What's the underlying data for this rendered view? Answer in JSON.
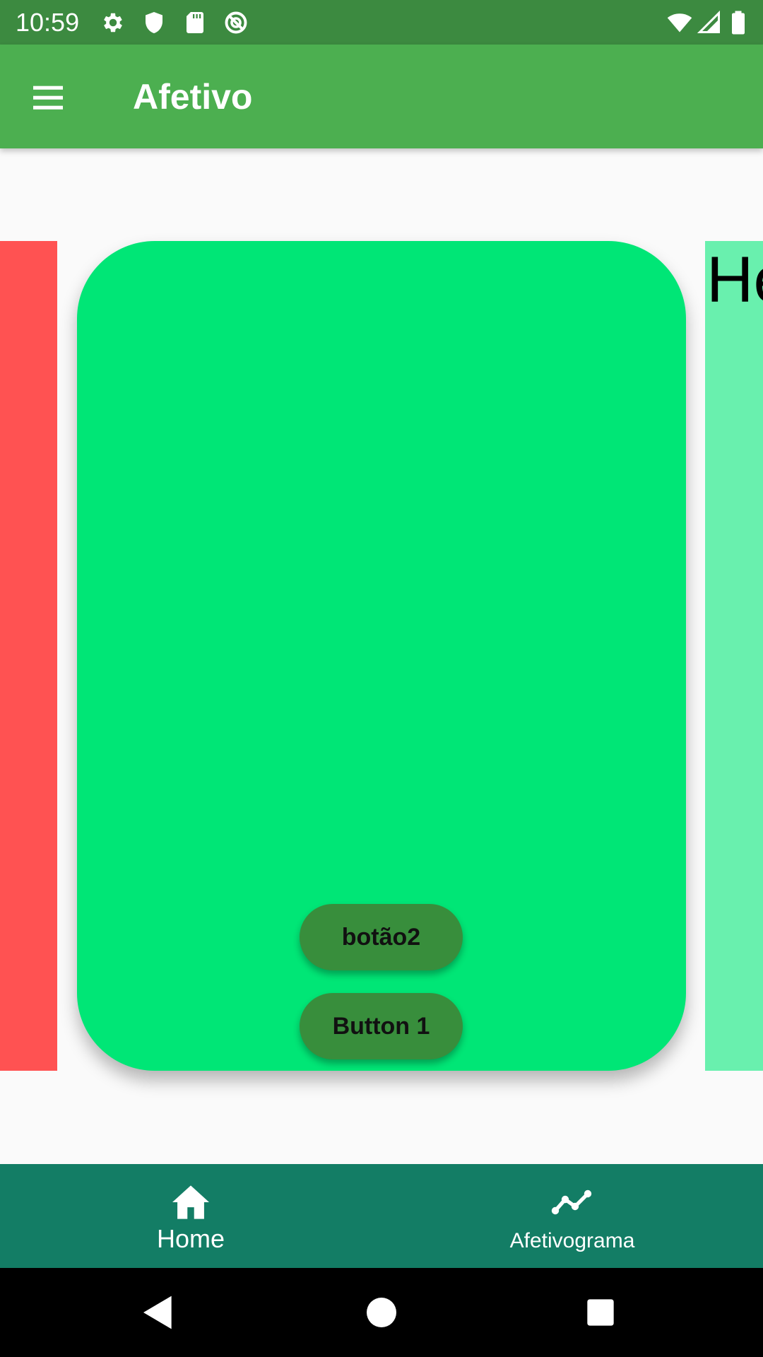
{
  "status_bar": {
    "time": "10:59",
    "icons": [
      "gear-icon",
      "shield-icon",
      "sd-card-icon",
      "no-disturb-icon",
      "wifi-icon",
      "signal-icon",
      "battery-icon"
    ],
    "background_color": "#3c8a40"
  },
  "app_bar": {
    "title": "Afetivo",
    "menu_icon": "hamburger-menu-icon",
    "background_color": "#4caf50"
  },
  "carousel": {
    "prev_page_color": "#ff5252",
    "current_card_color": "#00e676",
    "next_page_color": "#69f0ae",
    "next_page_text": "He",
    "buttons": {
      "button2_label": "botão2",
      "button1_label": "Button 1"
    },
    "button_color": "#388e3c"
  },
  "bottom_nav": {
    "background_color": "#137d65",
    "items": [
      {
        "label": "Home",
        "icon": "home-icon"
      },
      {
        "label": "Afetivograma",
        "icon": "line-chart-icon"
      }
    ]
  },
  "system_nav": {
    "buttons": [
      "back-icon",
      "home-circle-icon",
      "recents-icon"
    ]
  }
}
